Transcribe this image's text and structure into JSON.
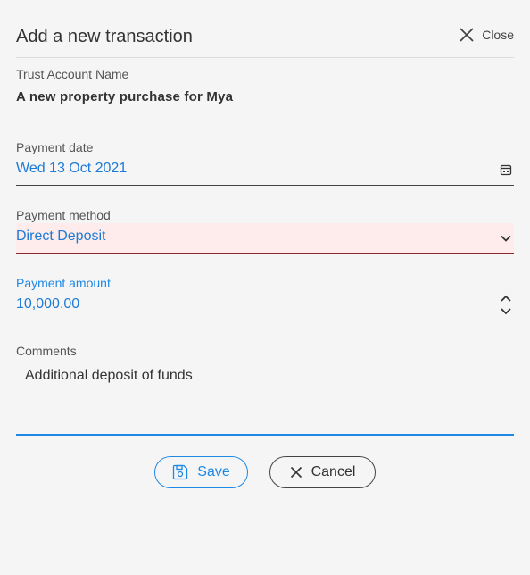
{
  "dialog": {
    "title": "Add a new transaction",
    "close_label": "Close"
  },
  "trust_account": {
    "label": "Trust Account Name",
    "value": "A new property purchase for Mya"
  },
  "payment_date": {
    "label": "Payment date",
    "value": "Wed 13 Oct 2021"
  },
  "payment_method": {
    "label": "Payment method",
    "value": "Direct Deposit"
  },
  "payment_amount": {
    "label": "Payment amount",
    "value": "10,000.00"
  },
  "comments": {
    "label": "Comments",
    "value": "Additional deposit of funds"
  },
  "actions": {
    "save_label": "Save",
    "cancel_label": "Cancel"
  },
  "colors": {
    "accent": "#1e88e5",
    "error_bg": "#fdeceb",
    "error_line": "#c0392b"
  }
}
